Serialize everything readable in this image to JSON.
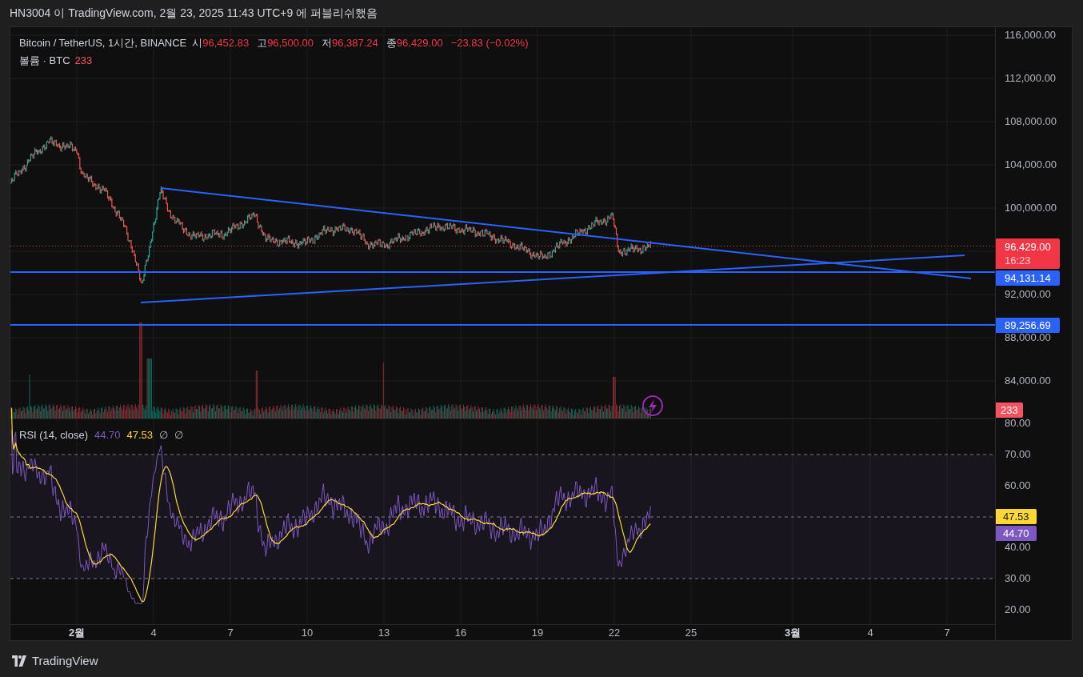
{
  "header": {
    "text": "HN3004 이 TradingView.com, 2월 23, 2025 11:43 UTC+9 에 퍼블리쉬했음"
  },
  "legend": {
    "symbol": "Bitcoin / TetherUS, 1시간, BINANCE",
    "ohlc": [
      {
        "label": "시",
        "value": "96,452.83"
      },
      {
        "label": "고",
        "value": "96,500.00"
      },
      {
        "label": "저",
        "value": "96,387.24"
      },
      {
        "label": "종",
        "value": "96,429.00"
      }
    ],
    "change": "−23.83 (−0.02%)"
  },
  "volume_legend": {
    "label": "볼륨 · BTC",
    "value": "233"
  },
  "price_axis": {
    "ticks": [
      "116,000.00",
      "112,000.00",
      "108,000.00",
      "104,000.00",
      "100,000.00",
      "92,000.00",
      "88,000.00",
      "84,000.00"
    ]
  },
  "price_labels": [
    {
      "kind": "last",
      "value": "96,429.00",
      "countdown": "16:23",
      "color": "#f23645"
    },
    {
      "kind": "line",
      "value": "94,131.14",
      "color": "#2962ff"
    },
    {
      "kind": "line",
      "value": "89,256.69",
      "color": "#2962ff"
    },
    {
      "kind": "volume",
      "value": "233",
      "color": "#f7525f"
    }
  ],
  "rsi": {
    "title": "RSI (14, close)",
    "values": [
      {
        "text": "44.70",
        "color": "#7e57c2"
      },
      {
        "text": "47.53",
        "color": "#fdd835"
      },
      {
        "text": "∅"
      },
      {
        "text": "∅"
      }
    ],
    "ticks": [
      "80.00",
      "70.00",
      "60.00",
      "40.00",
      "30.00",
      "20.00"
    ],
    "labels": [
      {
        "value": "47.53",
        "color": "#fdd835"
      },
      {
        "value": "44.70",
        "color": "#7e57c2"
      }
    ]
  },
  "time_axis": [
    {
      "label": "2월",
      "bold": true
    },
    {
      "label": "4",
      "bold": false
    },
    {
      "label": "7",
      "bold": false
    },
    {
      "label": "10",
      "bold": false
    },
    {
      "label": "13",
      "bold": false
    },
    {
      "label": "16",
      "bold": false
    },
    {
      "label": "19",
      "bold": false
    },
    {
      "label": "22",
      "bold": false
    },
    {
      "label": "25",
      "bold": false
    },
    {
      "label": "3월",
      "bold": true
    },
    {
      "label": "4",
      "bold": false
    },
    {
      "label": "7",
      "bold": false
    }
  ],
  "footer": {
    "logo": "TradingView"
  }
}
